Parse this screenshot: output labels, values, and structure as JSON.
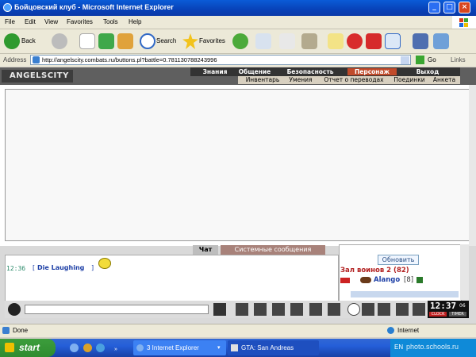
{
  "window": {
    "title": "Бойцовский клуб - Microsoft Internet Explorer"
  },
  "menu": [
    "File",
    "Edit",
    "View",
    "Favorites",
    "Tools",
    "Help"
  ],
  "toolbar": {
    "back_label": "Back",
    "search_label": "Search",
    "favorites_label": "Favorites"
  },
  "address": {
    "label": "Address",
    "url": "http://angelscity.combats.ru/buttons.pl?battle=0.781130788243996",
    "go_label": "Go",
    "links_label": "Links"
  },
  "site": {
    "logo": "ANGELSCITY",
    "nav_top": [
      "Знания",
      "Общение",
      "Безопасность",
      "Персонаж",
      "Выход"
    ],
    "nav_bottom": [
      "Инвентарь",
      "Умения",
      "Отчет о переводах",
      "Поединки",
      "Анкета"
    ]
  },
  "chat": {
    "tabs": [
      "Чат",
      "Системные сообщения"
    ],
    "message": {
      "time": "12:36",
      "open": "[",
      "text": "Die Laughing",
      "close": "]"
    }
  },
  "side": {
    "refresh_label": "Обновить",
    "hall_title": "Зал воинов 2 (82)",
    "player_name": "Alango",
    "player_level": "[8]"
  },
  "clock": {
    "time": "12:37",
    "date": "06",
    "badges": [
      "CLOCK",
      "TIMER"
    ]
  },
  "status": {
    "text": "Done",
    "zone": "Internet"
  },
  "taskbar": {
    "start_label": "start",
    "tasks": [
      "3 Internet Explorer",
      "GTA: San Andreas"
    ],
    "lang": "EN",
    "watermark": "photo.schools.ru"
  },
  "colors": {
    "titlebar": "#0842b8",
    "site_header": "#5f5f5f",
    "nav_active": "#c04a2a",
    "chat_tab_active": "#bdbdbd",
    "chat_tab_system": "#a8827a",
    "chat_time": "#2a8a6a",
    "chat_name": "#1d3fa6",
    "hall_title": "#b22020",
    "taskbar": "#245ed8",
    "start": "#2f8c2f"
  }
}
